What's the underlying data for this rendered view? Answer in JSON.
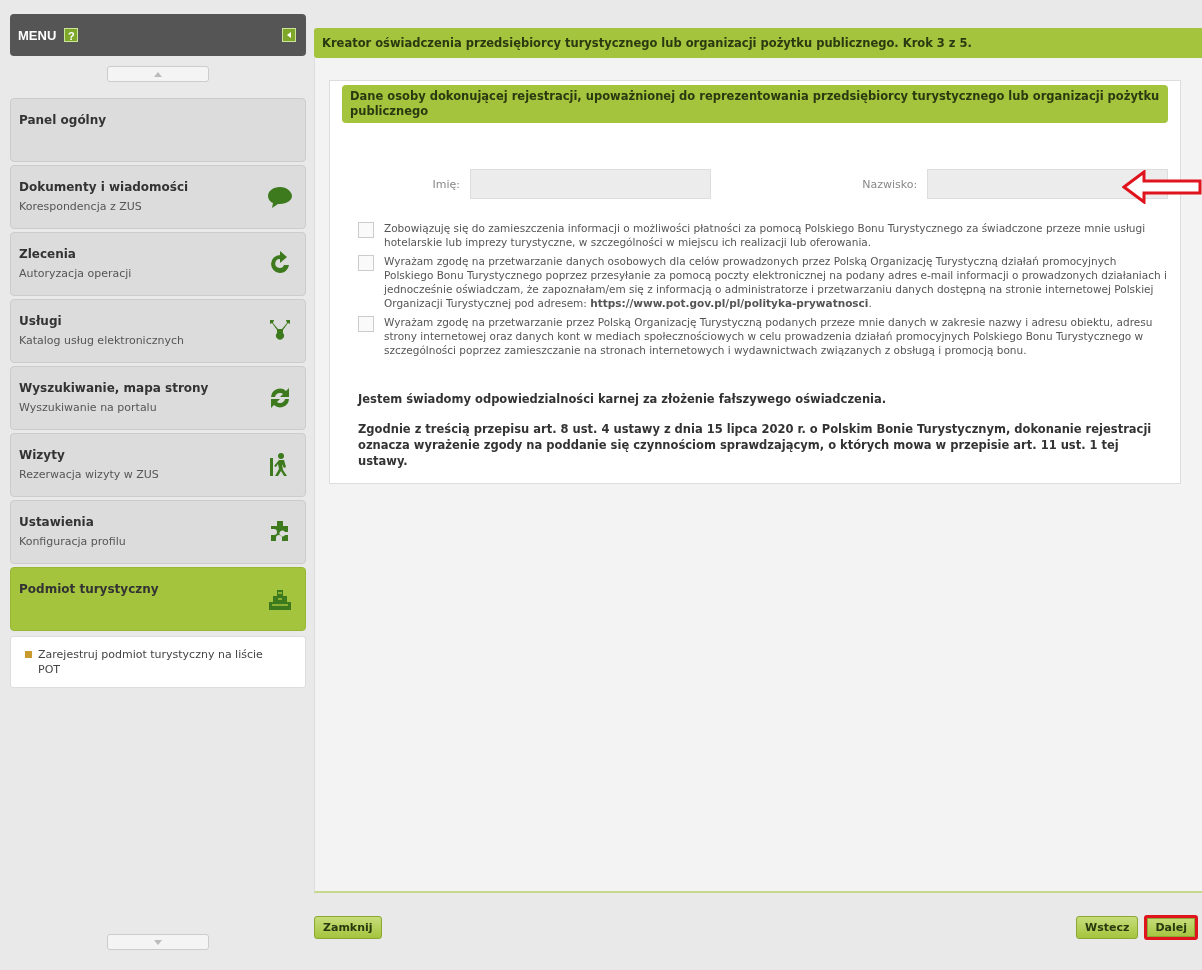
{
  "sidebar": {
    "title": "MENU",
    "help_label": "?",
    "items": [
      {
        "title": "Panel ogólny",
        "selected": false
      },
      {
        "title": "Dokumenty i wiadomości",
        "subtitle": "Korespondencja z ZUS",
        "selected": false
      },
      {
        "title": "Zlecenia",
        "subtitle": "Autoryzacja operacji",
        "selected": false
      },
      {
        "title": "Usługi",
        "subtitle": "Katalog usług elektronicznych",
        "selected": false
      },
      {
        "title": "Wyszukiwanie, mapa strony",
        "subtitle": "Wyszukiwanie na portalu",
        "selected": false
      },
      {
        "title": "Wizyty",
        "subtitle": "Rezerwacja wizyty w ZUS",
        "selected": false
      },
      {
        "title": "Ustawienia",
        "subtitle": "Konfiguracja profilu",
        "selected": false
      },
      {
        "title": "Podmiot turystyczny",
        "selected": true,
        "children": [
          {
            "label": "Zarejestruj podmiot turystyczny na liście POT"
          }
        ]
      }
    ]
  },
  "wizard": {
    "title": "Kreator oświadczenia przedsiębiorcy turystycznego lub organizacji pożytku publicznego. Krok 3 z 5.",
    "section_title": "Dane osoby dokonującej rejestracji, upoważnionej do reprezentowania przedsiębiorcy turystycznego lub organizacji pożytku publicznego",
    "fields": [
      {
        "label": "Imię:"
      },
      {
        "label": "Nazwisko:"
      }
    ],
    "consents": [
      {
        "text": "Zobowiązuję się do zamieszczenia informacji o możliwości płatności za pomocą Polskiego Bonu Turystycznego za świadczone przeze mnie usługi hotelarskie lub imprezy turystyczne, w szczególności w miejscu ich realizacji lub oferowania.",
        "checked": false
      },
      {
        "text": "Wyrażam zgodę na przetwarzanie danych osobowych dla celów prowadzonych przez Polską Organizację Turystyczną działań promocyjnych Polskiego Bonu Turystycznego poprzez przesyłanie za pomocą poczty elektronicznej na podany adres e-mail informacji o prowadzonych działaniach i jednocześnie oświadczam, że zapoznałam/em się z informacją o administratorze i przetwarzaniu danych dostępną na stronie internetowej Polskiej Organizacji Turystycznej pod adresem: **https://www.pot.gov.pl/pl/polityka-prywatnosci**.",
        "checked": false
      },
      {
        "text": "Wyrażam zgodę na przetwarzanie przez Polską Organizację Turystyczną podanych przeze mnie danych w zakresie nazwy i adresu obiektu, adresu strony internetowej oraz danych kont w mediach społecznościowych w celu prowadzenia działań promocyjnych Polskiego Bonu Turystycznego w szczególności poprzez zamieszczanie na stronach internetowych i wydawnictwach związanych z obsługą i promocją bonu.",
        "checked": false
      }
    ],
    "notes": [
      "Jestem świadomy odpowiedzialności karnej za złożenie fałszywego oświadczenia.",
      "Zgodnie z treścią przepisu art. 8 ust. 4 ustawy z dnia 15 lipca 2020 r. o Polskim Bonie Turystycznym, dokonanie rejestracji oznacza wyrażenie zgody na poddanie się czynnościom sprawdzającym, o których mowa w przepisie art. 11 ust. 1 tej ustawy."
    ]
  },
  "footer": {
    "left_buttons": [
      {
        "label": "Zamknij",
        "highlighted": false
      }
    ],
    "right_buttons": [
      {
        "label": "Wstecz",
        "highlighted": false
      },
      {
        "label": "Dalej",
        "highlighted": true
      }
    ]
  }
}
